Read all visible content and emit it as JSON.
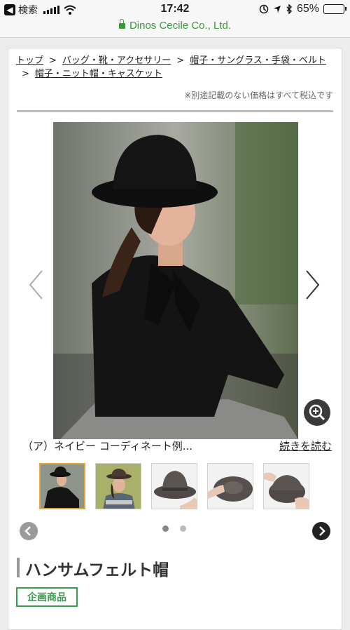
{
  "status_bar": {
    "back_label": "検索",
    "time": "17:42",
    "battery_percent": "65%",
    "battery_level": 0.65
  },
  "url_bar": {
    "domain": "Dinos Cecile Co., Ltd."
  },
  "breadcrumb": {
    "items": [
      "トップ",
      "バッグ・靴・アクセサリー",
      "帽子・サングラス・手袋・ベルト",
      "帽子・ニット帽・キャスケット"
    ],
    "separator": ">"
  },
  "tax_note": "※別途記載のない価格はすべて税込です",
  "gallery": {
    "caption": "（ア）ネイビー コーディネート例...",
    "read_more": "続きを読む",
    "thumbnail_count": 5,
    "page_count": 2,
    "current_page": 1
  },
  "product": {
    "title": "ハンサムフェルト帽",
    "badge": "企画商品"
  },
  "colors": {
    "accent_green": "#3c9a4c",
    "url_green": "#3a9a3a",
    "thumb_active": "#e8a53a"
  },
  "icons": [
    "back-icon",
    "signal-icon",
    "wifi-icon",
    "lock-icon",
    "location-icon",
    "bluetooth-icon",
    "battery-icon",
    "chevron-left-icon",
    "chevron-right-icon",
    "zoom-in-icon"
  ]
}
